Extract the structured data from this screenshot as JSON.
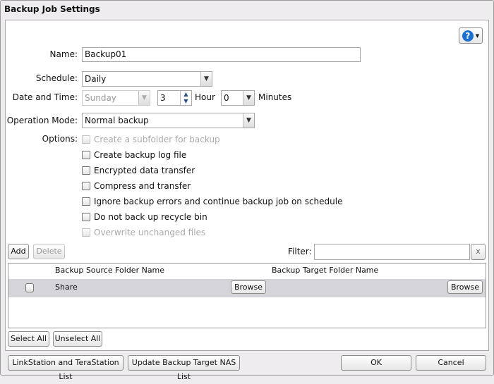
{
  "window": {
    "title": "Backup Job Settings"
  },
  "help": {
    "icon": "help-icon"
  },
  "form": {
    "name_label": "Name:",
    "name_value": "Backup01",
    "schedule_label": "Schedule:",
    "schedule_value": "Daily",
    "datetime_label": "Date and Time:",
    "day_value": "Sunday",
    "hour_value": "3",
    "hour_label": "Hour",
    "minute_value": "0",
    "minute_label": "Minutes",
    "mode_label": "Operation Mode:",
    "mode_value": "Normal backup",
    "options_label": "Options:",
    "options": [
      {
        "label": "Create a subfolder for backup",
        "checked": false,
        "disabled": true
      },
      {
        "label": "Create backup log file",
        "checked": false,
        "disabled": false
      },
      {
        "label": "Encrypted data transfer",
        "checked": false,
        "disabled": false
      },
      {
        "label": "Compress and transfer",
        "checked": false,
        "disabled": false
      },
      {
        "label": "Ignore backup errors and continue backup job on schedule",
        "checked": false,
        "disabled": false
      },
      {
        "label": "Do not back up recycle bin",
        "checked": false,
        "disabled": false
      },
      {
        "label": "Overwrite unchanged files",
        "checked": false,
        "disabled": true
      }
    ]
  },
  "list": {
    "add": "Add",
    "delete": "Delete",
    "filter_label": "Filter:",
    "filter_value": "",
    "clear": "x",
    "columns": [
      "Backup Source Folder Name",
      "Backup Target Folder Name"
    ],
    "rows": [
      {
        "source": "Share",
        "target": "",
        "browse": "Browse"
      }
    ],
    "select_all": "Select All",
    "unselect_all": "Unselect All"
  },
  "footer": {
    "linkstation": "LinkStation and TeraStation List",
    "update": "Update Backup Target NAS List",
    "ok": "OK",
    "cancel": "Cancel"
  }
}
